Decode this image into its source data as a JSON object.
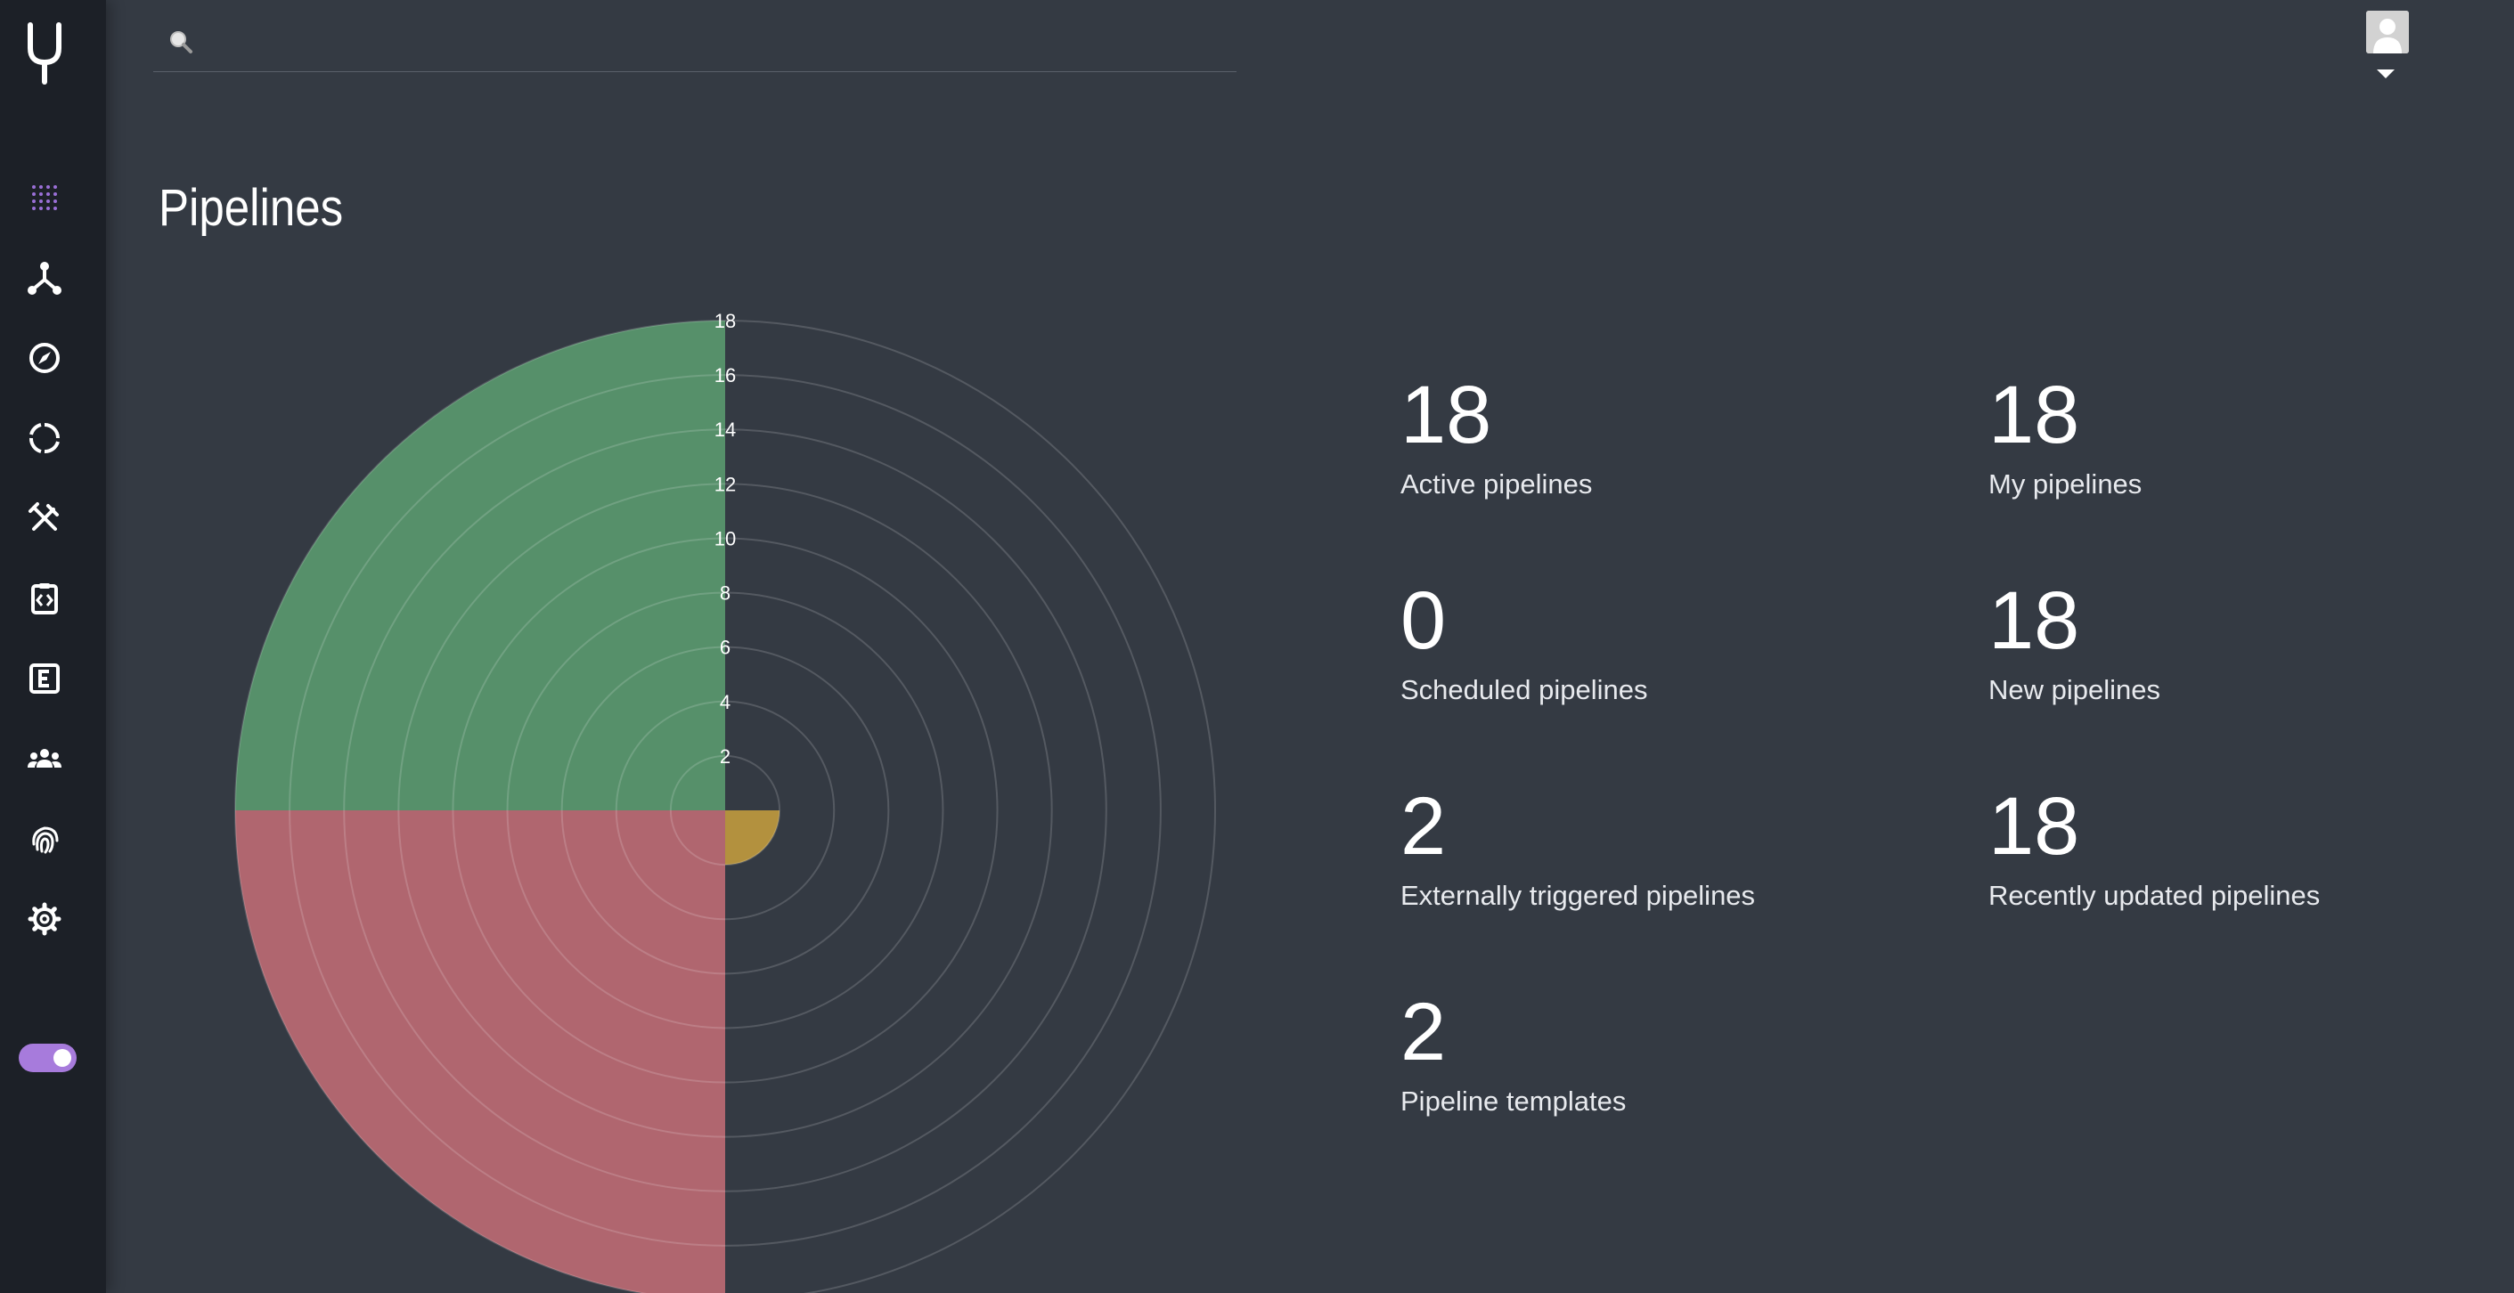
{
  "app": {
    "search": {
      "placeholder": ""
    },
    "page_title": "Pipelines"
  },
  "sidebar": {
    "items": [
      {
        "icon": "dashboard-dots-icon"
      },
      {
        "icon": "pipelines-network-icon"
      },
      {
        "icon": "compass-icon"
      },
      {
        "icon": "circle-arrows-icon"
      },
      {
        "icon": "build-tools-icon"
      },
      {
        "icon": "code-clipboard-icon"
      },
      {
        "icon": "entity-e-icon"
      },
      {
        "icon": "users-group-icon"
      },
      {
        "icon": "fingerprint-icon"
      },
      {
        "icon": "settings-gear-icon"
      }
    ],
    "theme_toggle": {
      "on": true
    }
  },
  "colors": {
    "background": "#343a43",
    "sidebar": "#1c2027",
    "accent": "#a77bdc",
    "green": "#56906a",
    "red": "#b0666f",
    "gold": "#b3913e"
  },
  "stats": [
    {
      "value": "18",
      "label": "Active pipelines"
    },
    {
      "value": "18",
      "label": "My pipelines"
    },
    {
      "value": "0",
      "label": "Scheduled pipelines"
    },
    {
      "value": "18",
      "label": "New pipelines"
    },
    {
      "value": "2",
      "label": "Externally triggered pipelines"
    },
    {
      "value": "18",
      "label": "Recently updated pipelines"
    },
    {
      "value": "2",
      "label": "Pipeline templates"
    }
  ],
  "chart_data": {
    "type": "polar-area",
    "radial_ticks": [
      "2",
      "4",
      "6",
      "8",
      "10",
      "12",
      "14",
      "16",
      "18"
    ],
    "rmax": 18,
    "series": [
      {
        "value": 18,
        "color": "#56906a"
      },
      {
        "value": 18,
        "color": "#b0666f"
      },
      {
        "value": 2,
        "color": "#b3913e"
      },
      {
        "value": 0,
        "color": "#b3913e"
      }
    ],
    "grid": true
  }
}
